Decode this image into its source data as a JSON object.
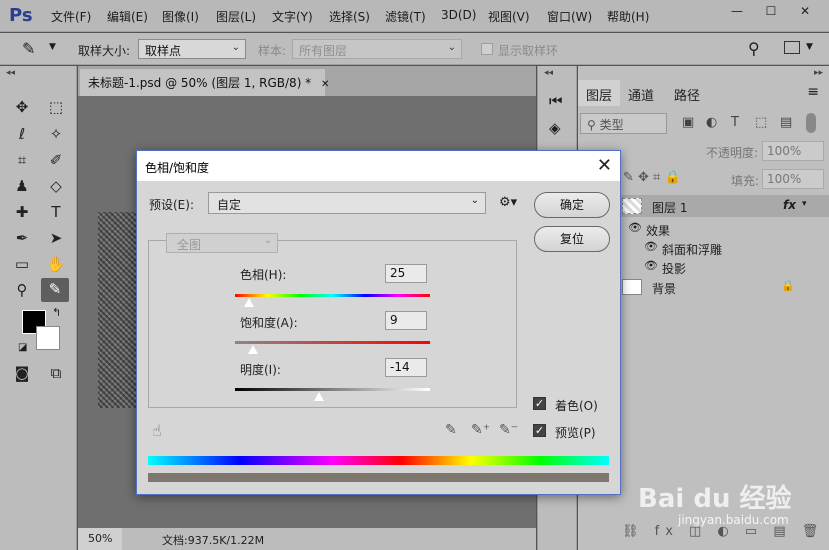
{
  "app": {
    "logo": "Ps"
  },
  "menu": [
    "文件(F)",
    "编辑(E)",
    "图像(I)",
    "图层(L)",
    "文字(Y)",
    "选择(S)",
    "滤镜(T)",
    "3D(D)",
    "视图(V)",
    "窗口(W)",
    "帮助(H)"
  ],
  "window_controls": {
    "minimize": "—",
    "maximize": "☐",
    "close": "✕"
  },
  "options": {
    "sample_size_label": "取样大小:",
    "sample_size_value": "取样点",
    "sample_label": "样本:",
    "sample_value": "所有图层",
    "show_ring_label": "显示取样环"
  },
  "document": {
    "tab_title": "未标题-1.psd @ 50% (图层 1, RGB/8) *",
    "tab_close": "✕",
    "zoom": "50%",
    "doc_info": "文档:937.5K/1.22M"
  },
  "layers_panel": {
    "tabs": [
      "图层",
      "通道",
      "路径"
    ],
    "filter_label": "类型",
    "opacity_label": "不透明度:",
    "opacity_value": "100%",
    "fill_label": "填充:",
    "fill_value": "100%",
    "layers": [
      {
        "name": "图层 1",
        "fx": "fx"
      },
      {
        "name": "效果"
      },
      {
        "name": "斜面和浮雕"
      },
      {
        "name": "投影"
      },
      {
        "name": "背景"
      }
    ]
  },
  "dialog": {
    "title": "色相/饱和度",
    "preset_label": "预设(E):",
    "preset_value": "自定",
    "channel_value": "全图",
    "ok_label": "确定",
    "reset_label": "复位",
    "hue_label": "色相(H):",
    "hue_value": "25",
    "saturation_label": "饱和度(A):",
    "saturation_value": "9",
    "lightness_label": "明度(I):",
    "lightness_value": "-14",
    "colorize_label": "着色(O)",
    "preview_label": "预览(P)",
    "hue_position": 0.07,
    "saturation_position": 0.09,
    "lightness_position": 0.43
  },
  "watermark": {
    "brand": "Bai du 经验",
    "url": "jingyan.baidu.com"
  },
  "colors": {
    "dialog_border": "#5470c4",
    "ps_blue": "#2c3e8f"
  }
}
